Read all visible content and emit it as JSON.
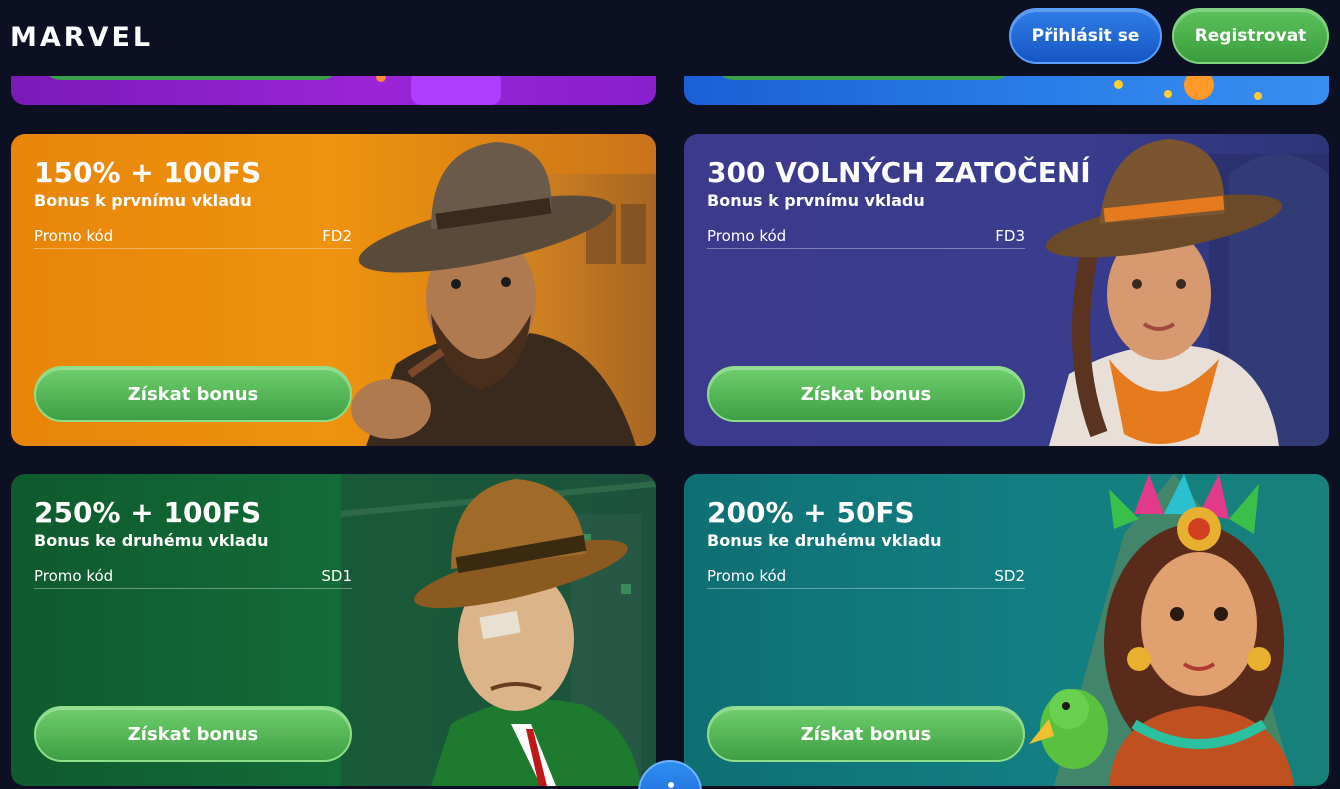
{
  "header": {
    "logo": "MARVEL",
    "login_label": "Přihlásit se",
    "register_label": "Registrovat"
  },
  "cards": [
    {
      "title": "150% + 100FS",
      "subtitle": "Bonus k prvnímu vkladu",
      "promo_label": "Promo kód",
      "promo_code": "FD2",
      "button_label": "Získat bonus"
    },
    {
      "title": "300 VOLNÝCH ZATOČENÍ",
      "subtitle": "Bonus k prvnímu vkladu",
      "promo_label": "Promo kód",
      "promo_code": "FD3",
      "button_label": "Získat bonus"
    },
    {
      "title": "250% + 100FS",
      "subtitle": "Bonus ke druhému vkladu",
      "promo_label": "Promo kód",
      "promo_code": "SD1",
      "button_label": "Získat bonus"
    },
    {
      "title": "200% + 50FS",
      "subtitle": "Bonus ke druhému vkladu",
      "promo_label": "Promo kód",
      "promo_code": "SD2",
      "button_label": "Získat bonus"
    }
  ],
  "colors": {
    "background": "#0d1023",
    "card_orange": "#ee930f",
    "card_indigo": "#3a3c8e",
    "card_green": "#136b37",
    "card_teal": "#127f82",
    "button_green": "#5cc25c",
    "button_blue": "#1f6ad8"
  }
}
